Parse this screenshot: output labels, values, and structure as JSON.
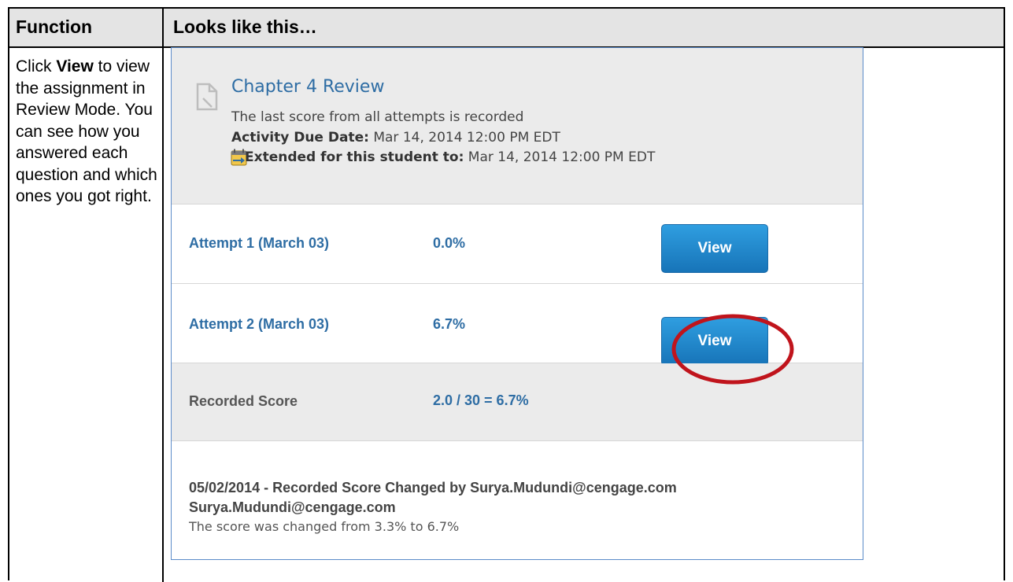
{
  "table": {
    "header": {
      "function": "Function",
      "looks_like": "Looks like this…"
    },
    "instruction": {
      "pre": "Click ",
      "bold": "View",
      "post": " to view the assignment in Review Mode. You can see how you answered each question and which ones you got right."
    }
  },
  "assignment": {
    "icon": "document-icon",
    "title": "Chapter 4 Review",
    "policy": "The last score from all attempts is recorded",
    "due_label": "Activity Due Date:",
    "due_value": " Mar 14, 2014 12:00 PM EDT",
    "extended_icon": "calendar-arrow-icon",
    "extended_label": "Extended for this student to:",
    "extended_value": " Mar 14, 2014 12:00 PM EDT"
  },
  "attempts": [
    {
      "label": "Attempt 1 (March 03)",
      "score": "0.0%",
      "button": "View"
    },
    {
      "label": "Attempt 2 (March 03)",
      "score": "6.7%",
      "button": "View"
    }
  ],
  "recorded": {
    "label": "Recorded Score",
    "value": "2.0 / 30 = 6.7%"
  },
  "history": {
    "line1": "05/02/2014 - Recorded Score Changed by Surya.Mudundi@cengage.com",
    "line2": "Surya.Mudundi@cengage.com",
    "line3": "The score was changed from 3.3% to 6.7%"
  },
  "colors": {
    "link_blue": "#2e6da4",
    "button_blue": "#1f8ad0",
    "highlight_red": "#c0141c",
    "panel_gray": "#ebebeb"
  }
}
